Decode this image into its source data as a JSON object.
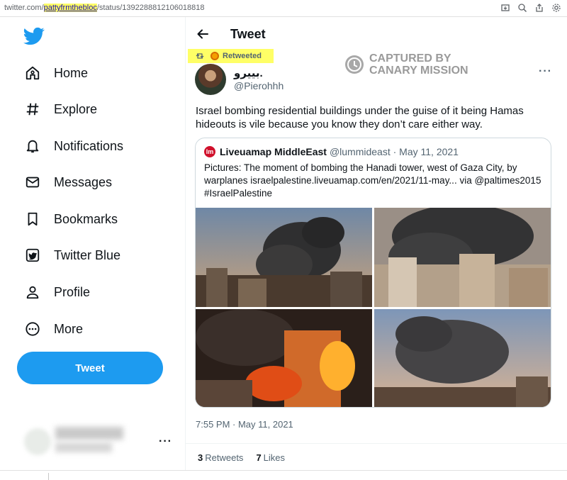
{
  "browser": {
    "url_prefix": "twitter.com/",
    "url_highlight": "pattyfrmthebloc",
    "url_suffix": "/status/1392288812106018818",
    "icons": [
      "screenshot-icon",
      "zoom-icon",
      "share-icon",
      "settings-icon"
    ]
  },
  "sidebar": {
    "logo": "twitter-bird-icon",
    "items": [
      {
        "label": "Home",
        "icon": "home-icon"
      },
      {
        "label": "Explore",
        "icon": "hashtag-icon"
      },
      {
        "label": "Notifications",
        "icon": "bell-icon"
      },
      {
        "label": "Messages",
        "icon": "envelope-icon"
      },
      {
        "label": "Bookmarks",
        "icon": "bookmark-icon"
      },
      {
        "label": "Twitter Blue",
        "icon": "twitter-blue-icon"
      },
      {
        "label": "Profile",
        "icon": "person-icon"
      },
      {
        "label": "More",
        "icon": "more-circle-icon"
      }
    ],
    "tweet_button": "Tweet",
    "account_more": "···"
  },
  "header": {
    "title": "Tweet"
  },
  "retweet": {
    "label": "Retweeted"
  },
  "watermark": {
    "line1": "CAPTURED BY",
    "line2": "CANARY MISSION"
  },
  "tweet": {
    "display_name": "بييرو.",
    "handle": "@Pierohhh",
    "more": "···",
    "text": "Israel bombing residential buildings under the guise of it being Hamas hideouts is vile because you know they don’t care either way.",
    "timestamp": "7:55 PM · May 11, 2021",
    "retweets_count": "3",
    "retweets_label": "Retweets",
    "likes_count": "7",
    "likes_label": "Likes"
  },
  "quote": {
    "icon_text": "lm",
    "name": "Liveuamap MiddleEast",
    "meta": "@lummideast · May 11, 2021",
    "text": "Pictures: The moment of bombing the Hanadi tower, west of Gaza City, by warplanes israelpalestine.liveuamap.com/en/2021/11-may... via @paltimes2015 #IsraelPalestine"
  },
  "colors": {
    "accent": "#1d9bf0",
    "highlight": "#ffff66",
    "text_secondary": "#536471"
  }
}
